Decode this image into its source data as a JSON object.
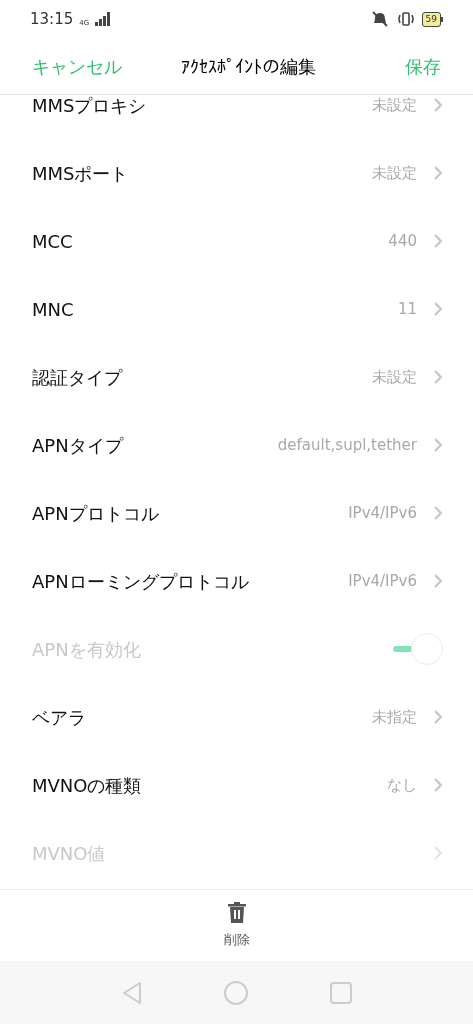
{
  "status_bar": {
    "time": "13:15",
    "network": "4G",
    "battery": "59"
  },
  "header": {
    "cancel": "キャンセル",
    "title": "ｱｸｾｽﾎﾟｲﾝﾄの編集",
    "save": "保存"
  },
  "rows": [
    {
      "kind": "value",
      "label": "MMSプロキシ",
      "value": "未設定",
      "disabled": false
    },
    {
      "kind": "value",
      "label": "MMSポート",
      "value": "未設定",
      "disabled": false
    },
    {
      "kind": "value",
      "label": "MCC",
      "value": "440",
      "disabled": false
    },
    {
      "kind": "value",
      "label": "MNC",
      "value": "11",
      "disabled": false
    },
    {
      "kind": "value",
      "label": "認証タイプ",
      "value": "未設定",
      "disabled": false
    },
    {
      "kind": "value",
      "label": "APNタイプ",
      "value": "default,supl,tether",
      "disabled": false
    },
    {
      "kind": "value",
      "label": "APNプロトコル",
      "value": "IPv4/IPv6",
      "disabled": false
    },
    {
      "kind": "value",
      "label": "APNローミングプロトコル",
      "value": "IPv4/IPv6",
      "disabled": false
    },
    {
      "kind": "toggle",
      "label": "APNを有効化",
      "on": true,
      "disabled": true
    },
    {
      "kind": "value",
      "label": "ベアラ",
      "value": "未指定",
      "disabled": false
    },
    {
      "kind": "value",
      "label": "MVNOの種類",
      "value": "なし",
      "disabled": false
    },
    {
      "kind": "value",
      "label": "MVNO値",
      "disabled": true
    }
  ],
  "bottom_action": {
    "label": "削除"
  }
}
